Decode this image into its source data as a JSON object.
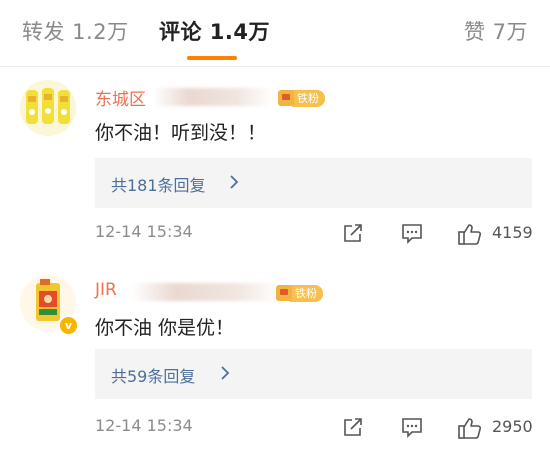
{
  "tabs": {
    "repost": "转发 1.2万",
    "comments": "评论 1.4万",
    "likes": "赞 7万"
  },
  "colors": {
    "accent": "#ff8200",
    "username": "#eb7350",
    "reply_link": "#4d6f9c",
    "fan_badge": "#f5c04d"
  },
  "comments": [
    {
      "username": "东城区",
      "fan_badge": "铁粉",
      "text": "你不油！听到没！！",
      "replies_link": "共181条回复",
      "time": "12-14 15:34",
      "likes": "4159"
    },
    {
      "username": "JIR",
      "fan_badge": "铁粉",
      "text": "你不油 你是优！",
      "replies_link": "共59条回复",
      "time": "12-14 15:34",
      "likes": "2950",
      "verified_badge": "v"
    }
  ],
  "icons": {
    "repost": "repost-icon",
    "comment": "comment-icon",
    "like": "thumbs-up-icon",
    "chevron": "chevron-right-icon"
  }
}
